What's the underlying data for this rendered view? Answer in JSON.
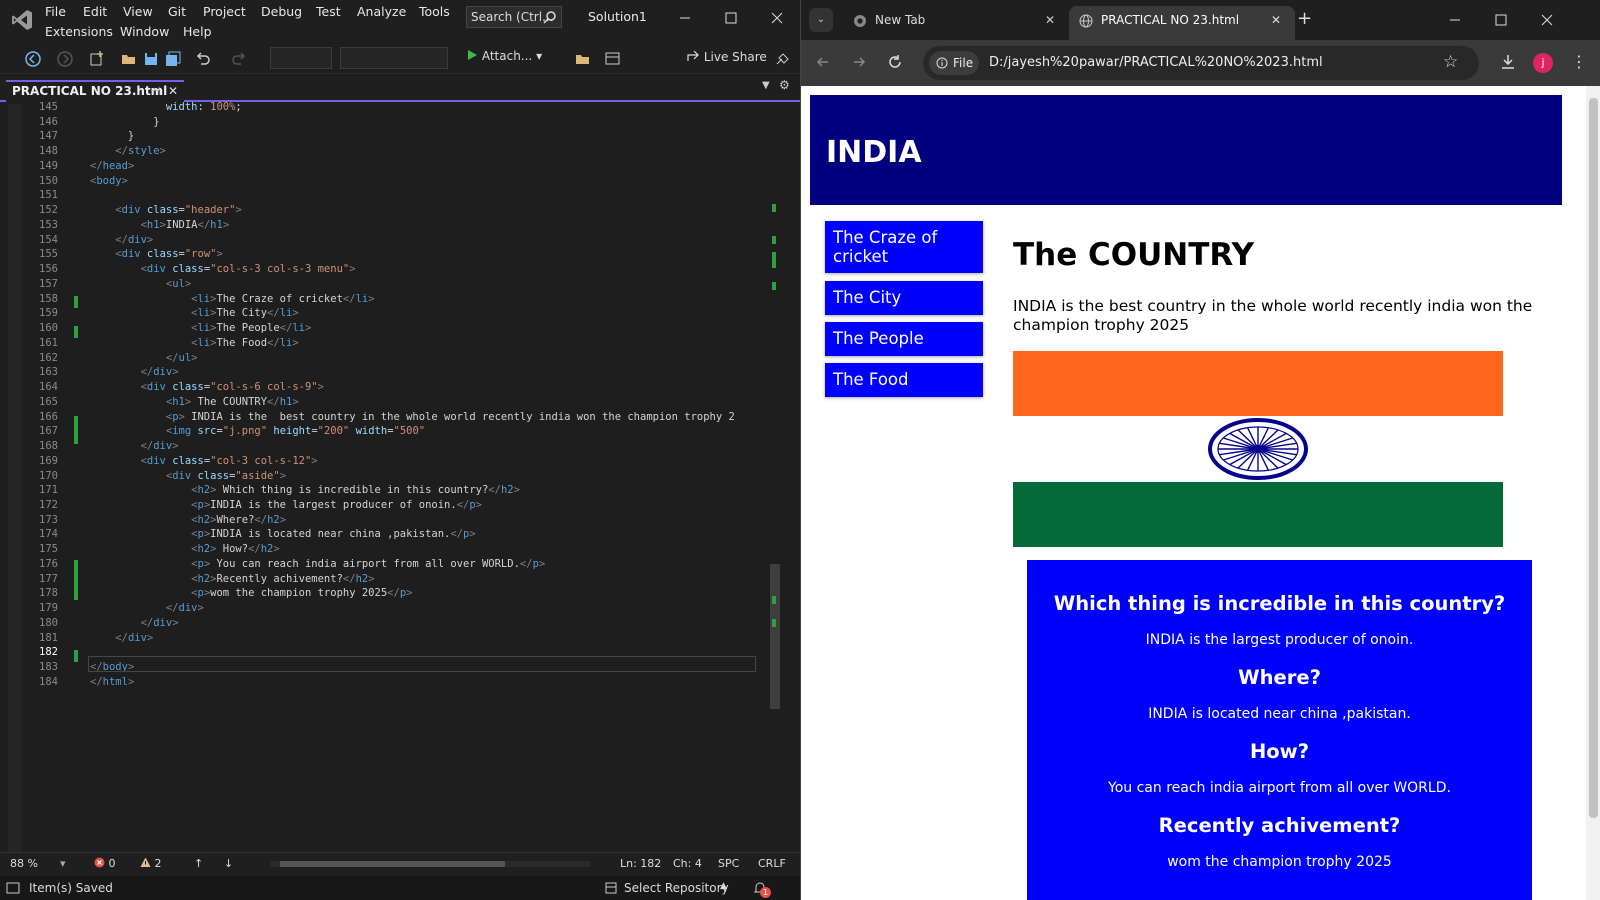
{
  "vs": {
    "menu_row1": [
      "File",
      "Edit",
      "View",
      "Git",
      "Project",
      "Debug",
      "Test",
      "Analyze",
      "Tools"
    ],
    "menu_row2": [
      "Extensions",
      "Window",
      "Help"
    ],
    "search": "Search (Ctrl...",
    "solution": "Solution1",
    "toolbar": {
      "attach": "Attach...",
      "live_share": "Live Share"
    },
    "tab": {
      "title": "PRACTICAL NO 23.html"
    },
    "line_numbers": [
      "145",
      "146",
      "147",
      "148",
      "149",
      "150",
      "151",
      "152",
      "153",
      "154",
      "155",
      "156",
      "157",
      "158",
      "159",
      "160",
      "161",
      "162",
      "163",
      "164",
      "165",
      "166",
      "167",
      "168",
      "169",
      "170",
      "171",
      "172",
      "173",
      "174",
      "175",
      "176",
      "177",
      "178",
      "179",
      "180",
      "181",
      "182",
      "183",
      "184"
    ],
    "status": {
      "zoom": "88 %",
      "errors": "0",
      "warnings": "2",
      "line": "Ln: 182",
      "col": "Ch: 4",
      "spc": "SPC",
      "crlf": "CRLF"
    },
    "bottom": {
      "saved": "Item(s) Saved",
      "repo": "Select Repository",
      "notifications": "1"
    }
  },
  "chrome": {
    "tabs": [
      {
        "title": "New Tab"
      },
      {
        "title": "PRACTICAL NO 23.html"
      }
    ],
    "file_chip": "File",
    "url": "D:/jayesh%20pawar/PRACTICAL%20NO%2023.html",
    "profile_initial": "j"
  },
  "page": {
    "header": "INDIA",
    "menu": [
      "The Craze of cricket",
      "The City",
      "The People",
      "The Food"
    ],
    "title": "The COUNTRY",
    "desc": "INDIA is the best country in the whole world recently india won the champion trophy 2025",
    "aside": [
      {
        "h2": "Which thing is incredible in this country?",
        "p": "INDIA is the largest producer of onoin."
      },
      {
        "h2": "Where?",
        "p": "INDIA is located near china ,pakistan."
      },
      {
        "h2": "How?",
        "p": "You can reach india airport from all over WORLD."
      },
      {
        "h2": "Recently achivement?",
        "p": "wom the champion trophy 2025"
      }
    ]
  },
  "colors": {
    "header_bg": "#000080",
    "menu_bg": "#0000ff",
    "aside_bg": "#0000ff",
    "saffron": "#ff671f",
    "green": "#046a38",
    "chakra": "#06038d",
    "vs_accent": "#7160e8"
  }
}
